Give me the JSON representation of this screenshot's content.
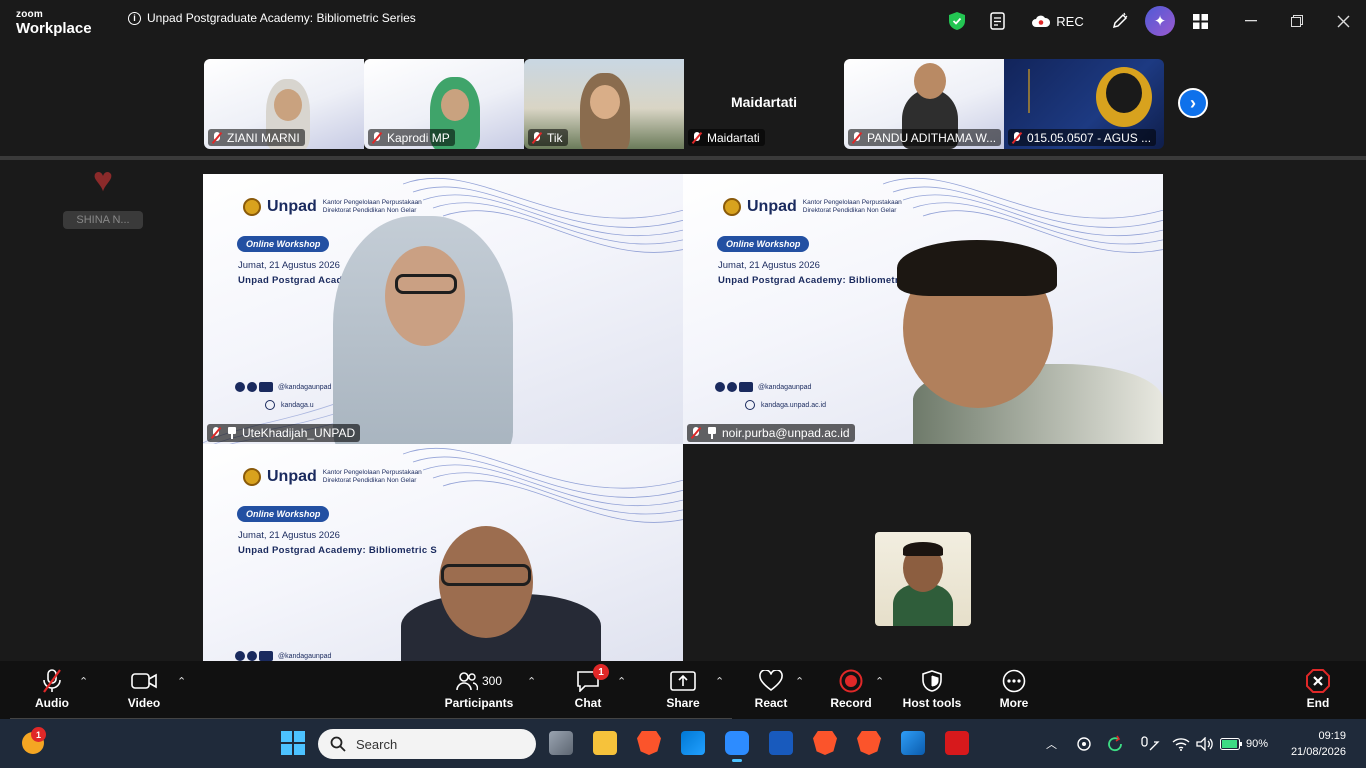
{
  "window": {
    "brand_line1": "zoom",
    "brand_line2": "Workplace",
    "meeting_title": "Unpad Postgraduate Academy: Bibliometric Series",
    "rec_label": "REC",
    "controls": [
      "minimize",
      "restore",
      "close"
    ]
  },
  "strip": {
    "participants": [
      {
        "name": "ZIANI MARNI"
      },
      {
        "name": "Kaprodi MP"
      },
      {
        "name": "Tik"
      },
      {
        "name": "Maidartati",
        "center_label": "Maidartati"
      },
      {
        "name": "PANDU ADITHAMA W..."
      },
      {
        "name": "015.05.0507 - AGUS ..."
      }
    ]
  },
  "reaction": {
    "emoji": "heart",
    "name": "SHINA N..."
  },
  "slide": {
    "brand": "Unpad",
    "brand_sub1": "Kantor Pengelolaan Perpustakaan",
    "brand_sub2": "Direktorat Pendidikan Non Gelar",
    "pill": "Online Workshop",
    "date": "Jumat, 21 Agustus 2026",
    "title1": "Unpad Postgrad Academy:",
    "title2": "Unpad Postgrad Academy: Bibliometri",
    "title3": "Unpad Postgrad Academy: Bibliometric S",
    "handle": "@kandagaunpad",
    "handle2": "@kandagaunpad",
    "site": "kandaga.unpad.ac.id",
    "site_short": "kandaga.u"
  },
  "tiles": [
    {
      "name": "UteKhadijah_UNPAD"
    },
    {
      "name": "noir.purba@unpad.ac.id"
    },
    {
      "name": ""
    }
  ],
  "toolbar": {
    "audio": "Audio",
    "video": "Video",
    "participants": "Participants",
    "participants_count": "300",
    "chat": "Chat",
    "chat_badge": "1",
    "share": "Share",
    "react": "React",
    "record": "Record",
    "host_tools": "Host tools",
    "more": "More",
    "end": "End"
  },
  "taskbar": {
    "search_placeholder": "Search",
    "weather_badge": "1",
    "battery": "90%",
    "time": "09:19",
    "date": "21/08/2026"
  },
  "colors": {
    "accent": "#0e71eb",
    "record": "#e02828",
    "slide_navy": "#1a2a5e"
  }
}
